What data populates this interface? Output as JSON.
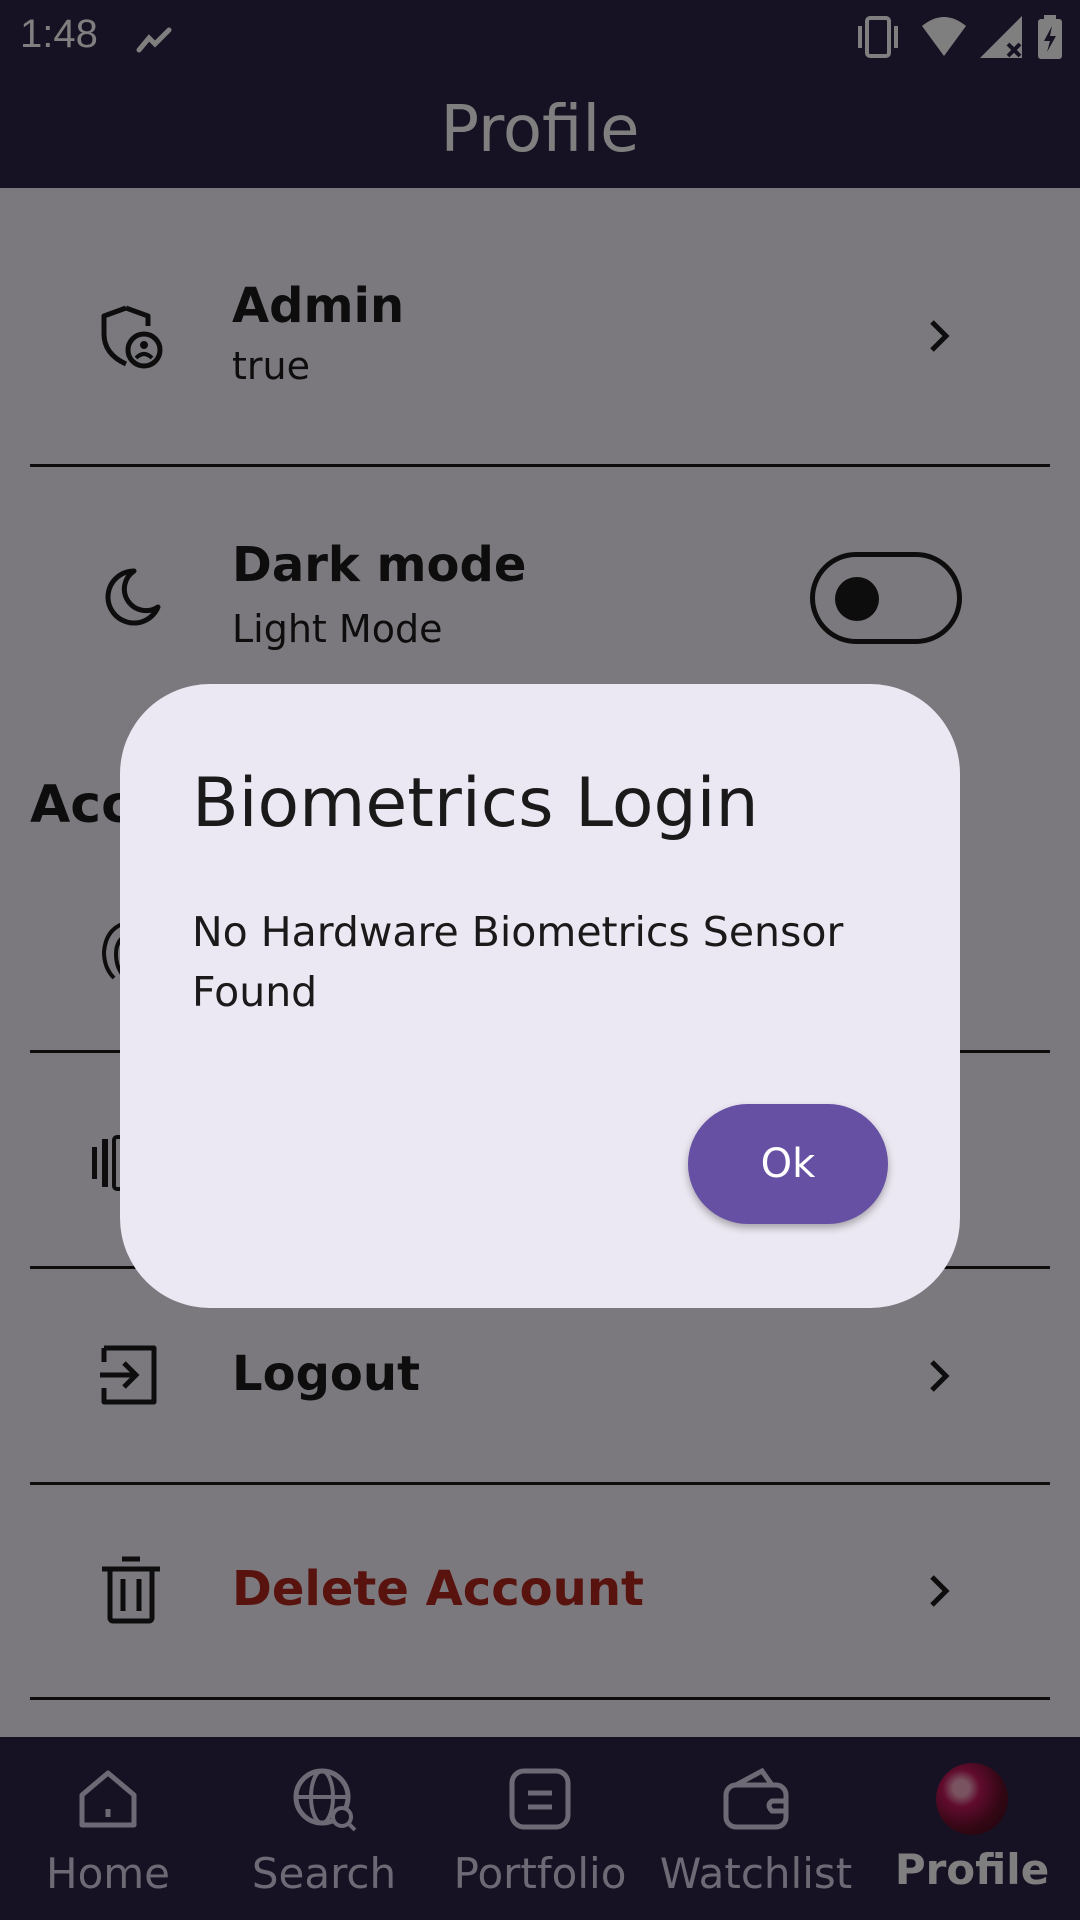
{
  "status_bar": {
    "time": "1:48"
  },
  "app_bar": {
    "title": "Profile"
  },
  "list": {
    "admin": {
      "title": "Admin",
      "subtitle": "true"
    },
    "dark_mode": {
      "title": "Dark mode",
      "subtitle": "Light Mode",
      "toggle_on": false
    },
    "section_heading": "Acc",
    "logout": {
      "title": "Logout"
    },
    "delete": {
      "title": "Delete Account"
    }
  },
  "dialog": {
    "title": "Biometrics Login",
    "body": "No Hardware Biometrics Sensor Found",
    "ok_label": "Ok"
  },
  "bottom_nav": {
    "items": [
      {
        "label": "Home",
        "icon": "home-icon"
      },
      {
        "label": "Search",
        "icon": "globe-search-icon"
      },
      {
        "label": "Portfolio",
        "icon": "portfolio-icon"
      },
      {
        "label": "Watchlist",
        "icon": "wallet-icon"
      },
      {
        "label": "Profile",
        "icon": "avatar",
        "active": true
      }
    ]
  },
  "colors": {
    "bar": "#2f2446",
    "accent": "#6650a4",
    "danger": "#b3261e",
    "dialog_bg": "#ece8f3"
  }
}
